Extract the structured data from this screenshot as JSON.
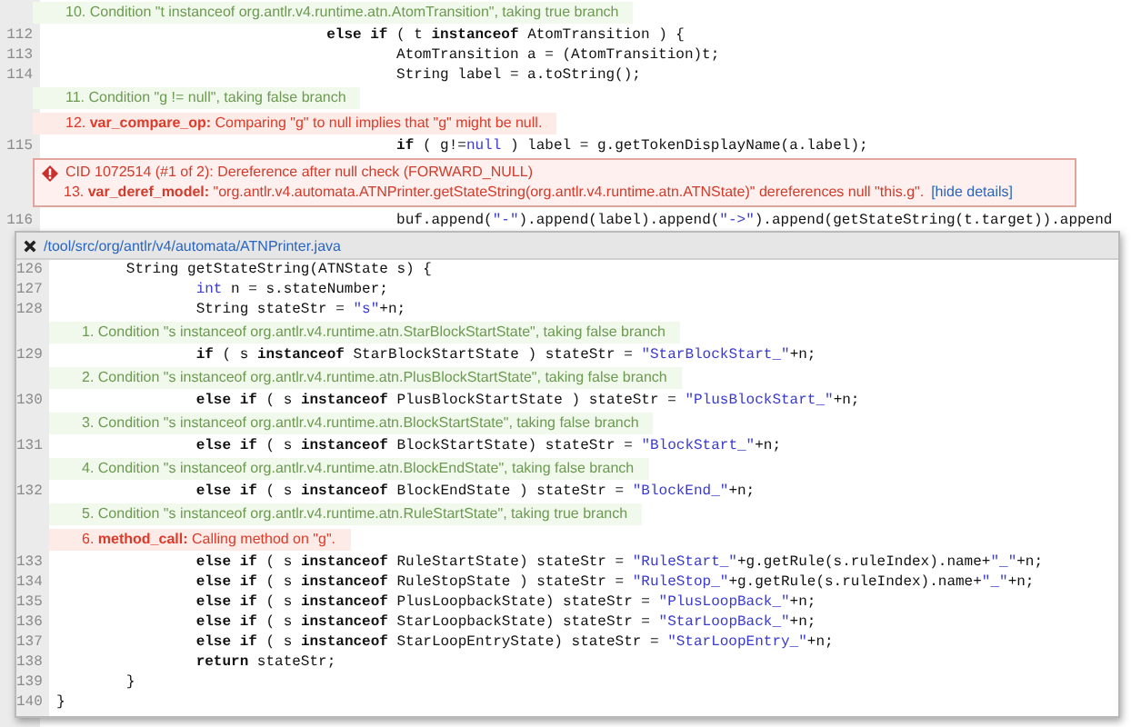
{
  "code_view": {
    "rows": [
      {
        "kind": "condition_event",
        "text": "10. Condition \"t instanceof org.antlr.v4.runtime.atn.AtomTransition\", taking true branch"
      },
      {
        "kind": "line",
        "number": "112",
        "code": [
          {
            "kind": "keyword",
            "text": "                                else if"
          },
          {
            "kind": "text",
            "text": " ( t "
          },
          {
            "kind": "keyword",
            "text": "instanceof"
          },
          {
            "kind": "text",
            "text": " AtomTransition ) {"
          }
        ]
      },
      {
        "kind": "line",
        "number": "113",
        "code": [
          {
            "kind": "text",
            "text": "                                        AtomTransition a = (AtomTransition)t;"
          }
        ]
      },
      {
        "kind": "line",
        "number": "114",
        "code": [
          {
            "kind": "text",
            "text": "                                        String label = a.toString();"
          }
        ]
      },
      {
        "kind": "condition_event",
        "text": "11. Condition \"g != null\", taking false branch"
      },
      {
        "kind": "model_event",
        "text": "12. **var_compare_op:** Comparing \"g\" to null implies that \"g\" might be null."
      },
      {
        "kind": "line",
        "number": "115",
        "code": [
          {
            "kind": "keyword",
            "text": "                                        if"
          },
          {
            "kind": "text",
            "text": " ( g!="
          },
          {
            "kind": "literal",
            "text": "null"
          },
          {
            "kind": "text",
            "text": " ) label = g.getTokenDisplayName(a.label);"
          }
        ]
      },
      {
        "kind": "defect",
        "title": "CID 1072514 (#1 of 2): Dereference after null check (FORWARD_NULL)",
        "text": "13. **var_deref_model:** \"org.antlr.v4.automata.ATNPrinter.getStateString(org.antlr.v4.runtime.atn.ATNState)\" dereferences null \"this.g\".",
        "link": "[hide details]"
      },
      {
        "kind": "line",
        "number": "116",
        "code": [
          {
            "kind": "text",
            "text": "                                        buf.append("
          },
          {
            "kind": "literal",
            "text": "\"-\""
          },
          {
            "kind": "text",
            "text": ").append(label).append("
          },
          {
            "kind": "literal",
            "text": "\"->\""
          },
          {
            "kind": "text",
            "text": ").append(getStateString(t.target)).append"
          }
        ]
      }
    ]
  },
  "popup": {
    "path": "/tool/src/org/antlr/v4/automata/ATNPrinter.java",
    "rows": [
      {
        "kind": "line",
        "number": "126",
        "code": [
          {
            "kind": "text",
            "text": "        String getStateString(ATNState s) {"
          }
        ]
      },
      {
        "kind": "line",
        "number": "127",
        "code": [
          {
            "kind": "literal",
            "text": "                int"
          },
          {
            "kind": "text",
            "text": " n = s.stateNumber;"
          }
        ]
      },
      {
        "kind": "line",
        "number": "128",
        "code": [
          {
            "kind": "text",
            "text": "                String stateStr = "
          },
          {
            "kind": "literal",
            "text": "\"s\""
          },
          {
            "kind": "text",
            "text": "+n;"
          }
        ]
      },
      {
        "kind": "condition_event",
        "text": "1. Condition \"s instanceof org.antlr.v4.runtime.atn.StarBlockStartState\", taking false branch"
      },
      {
        "kind": "line",
        "number": "129",
        "code": [
          {
            "kind": "keyword",
            "text": "                if"
          },
          {
            "kind": "text",
            "text": " ( s "
          },
          {
            "kind": "keyword",
            "text": "instanceof"
          },
          {
            "kind": "text",
            "text": " StarBlockStartState ) stateStr = "
          },
          {
            "kind": "literal",
            "text": "\"StarBlockStart_\""
          },
          {
            "kind": "text",
            "text": "+n;"
          }
        ]
      },
      {
        "kind": "condition_event",
        "text": "2. Condition \"s instanceof org.antlr.v4.runtime.atn.PlusBlockStartState\", taking false branch"
      },
      {
        "kind": "line",
        "number": "130",
        "code": [
          {
            "kind": "keyword",
            "text": "                else if"
          },
          {
            "kind": "text",
            "text": " ( s "
          },
          {
            "kind": "keyword",
            "text": "instanceof"
          },
          {
            "kind": "text",
            "text": " PlusBlockStartState ) stateStr = "
          },
          {
            "kind": "literal",
            "text": "\"PlusBlockStart_\""
          },
          {
            "kind": "text",
            "text": "+n;"
          }
        ]
      },
      {
        "kind": "condition_event",
        "text": "3. Condition \"s instanceof org.antlr.v4.runtime.atn.BlockStartState\", taking false branch"
      },
      {
        "kind": "line",
        "number": "131",
        "code": [
          {
            "kind": "keyword",
            "text": "                else if"
          },
          {
            "kind": "text",
            "text": " ( s "
          },
          {
            "kind": "keyword",
            "text": "instanceof"
          },
          {
            "kind": "text",
            "text": " BlockStartState) stateStr = "
          },
          {
            "kind": "literal",
            "text": "\"BlockStart_\""
          },
          {
            "kind": "text",
            "text": "+n;"
          }
        ]
      },
      {
        "kind": "condition_event",
        "text": "4. Condition \"s instanceof org.antlr.v4.runtime.atn.BlockEndState\", taking false branch"
      },
      {
        "kind": "line",
        "number": "132",
        "code": [
          {
            "kind": "keyword",
            "text": "                else if"
          },
          {
            "kind": "text",
            "text": " ( s "
          },
          {
            "kind": "keyword",
            "text": "instanceof"
          },
          {
            "kind": "text",
            "text": " BlockEndState ) stateStr = "
          },
          {
            "kind": "literal",
            "text": "\"BlockEnd_\""
          },
          {
            "kind": "text",
            "text": "+n;"
          }
        ]
      },
      {
        "kind": "condition_event",
        "text": "5. Condition \"s instanceof org.antlr.v4.runtime.atn.RuleStartState\", taking true branch"
      },
      {
        "kind": "model_event",
        "text": "6. **method_call:** Calling method on \"g\"."
      },
      {
        "kind": "line",
        "number": "133",
        "code": [
          {
            "kind": "keyword",
            "text": "                else if"
          },
          {
            "kind": "text",
            "text": " ( s "
          },
          {
            "kind": "keyword",
            "text": "instanceof"
          },
          {
            "kind": "text",
            "text": " RuleStartState) stateStr = "
          },
          {
            "kind": "literal",
            "text": "\"RuleStart_\""
          },
          {
            "kind": "text",
            "text": "+g.getRule(s.ruleIndex).name+"
          },
          {
            "kind": "literal",
            "text": "\"_\""
          },
          {
            "kind": "text",
            "text": "+n;"
          }
        ]
      },
      {
        "kind": "line",
        "number": "134",
        "code": [
          {
            "kind": "keyword",
            "text": "                else if"
          },
          {
            "kind": "text",
            "text": " ( s "
          },
          {
            "kind": "keyword",
            "text": "instanceof"
          },
          {
            "kind": "text",
            "text": " RuleStopState ) stateStr = "
          },
          {
            "kind": "literal",
            "text": "\"RuleStop_\""
          },
          {
            "kind": "text",
            "text": "+g.getRule(s.ruleIndex).name+"
          },
          {
            "kind": "literal",
            "text": "\"_\""
          },
          {
            "kind": "text",
            "text": "+n;"
          }
        ]
      },
      {
        "kind": "line",
        "number": "135",
        "code": [
          {
            "kind": "keyword",
            "text": "                else if"
          },
          {
            "kind": "text",
            "text": " ( s "
          },
          {
            "kind": "keyword",
            "text": "instanceof"
          },
          {
            "kind": "text",
            "text": " PlusLoopbackState) stateStr = "
          },
          {
            "kind": "literal",
            "text": "\"PlusLoopBack_\""
          },
          {
            "kind": "text",
            "text": "+n;"
          }
        ]
      },
      {
        "kind": "line",
        "number": "136",
        "code": [
          {
            "kind": "keyword",
            "text": "                else if"
          },
          {
            "kind": "text",
            "text": " ( s "
          },
          {
            "kind": "keyword",
            "text": "instanceof"
          },
          {
            "kind": "text",
            "text": " StarLoopbackState) stateStr = "
          },
          {
            "kind": "literal",
            "text": "\"StarLoopBack_\""
          },
          {
            "kind": "text",
            "text": "+n;"
          }
        ]
      },
      {
        "kind": "line",
        "number": "137",
        "code": [
          {
            "kind": "keyword",
            "text": "                else if"
          },
          {
            "kind": "text",
            "text": " ( s "
          },
          {
            "kind": "keyword",
            "text": "instanceof"
          },
          {
            "kind": "text",
            "text": " StarLoopEntryState) stateStr = "
          },
          {
            "kind": "literal",
            "text": "\"StarLoopEntry_\""
          },
          {
            "kind": "text",
            "text": "+n;"
          }
        ]
      },
      {
        "kind": "line",
        "number": "138",
        "code": [
          {
            "kind": "keyword",
            "text": "                return"
          },
          {
            "kind": "text",
            "text": " stateStr;"
          }
        ]
      },
      {
        "kind": "line",
        "number": "139",
        "code": [
          {
            "kind": "text",
            "text": "        }"
          }
        ]
      },
      {
        "kind": "line",
        "number": "140",
        "code": [
          {
            "kind": "text",
            "text": "}"
          }
        ]
      }
    ]
  }
}
